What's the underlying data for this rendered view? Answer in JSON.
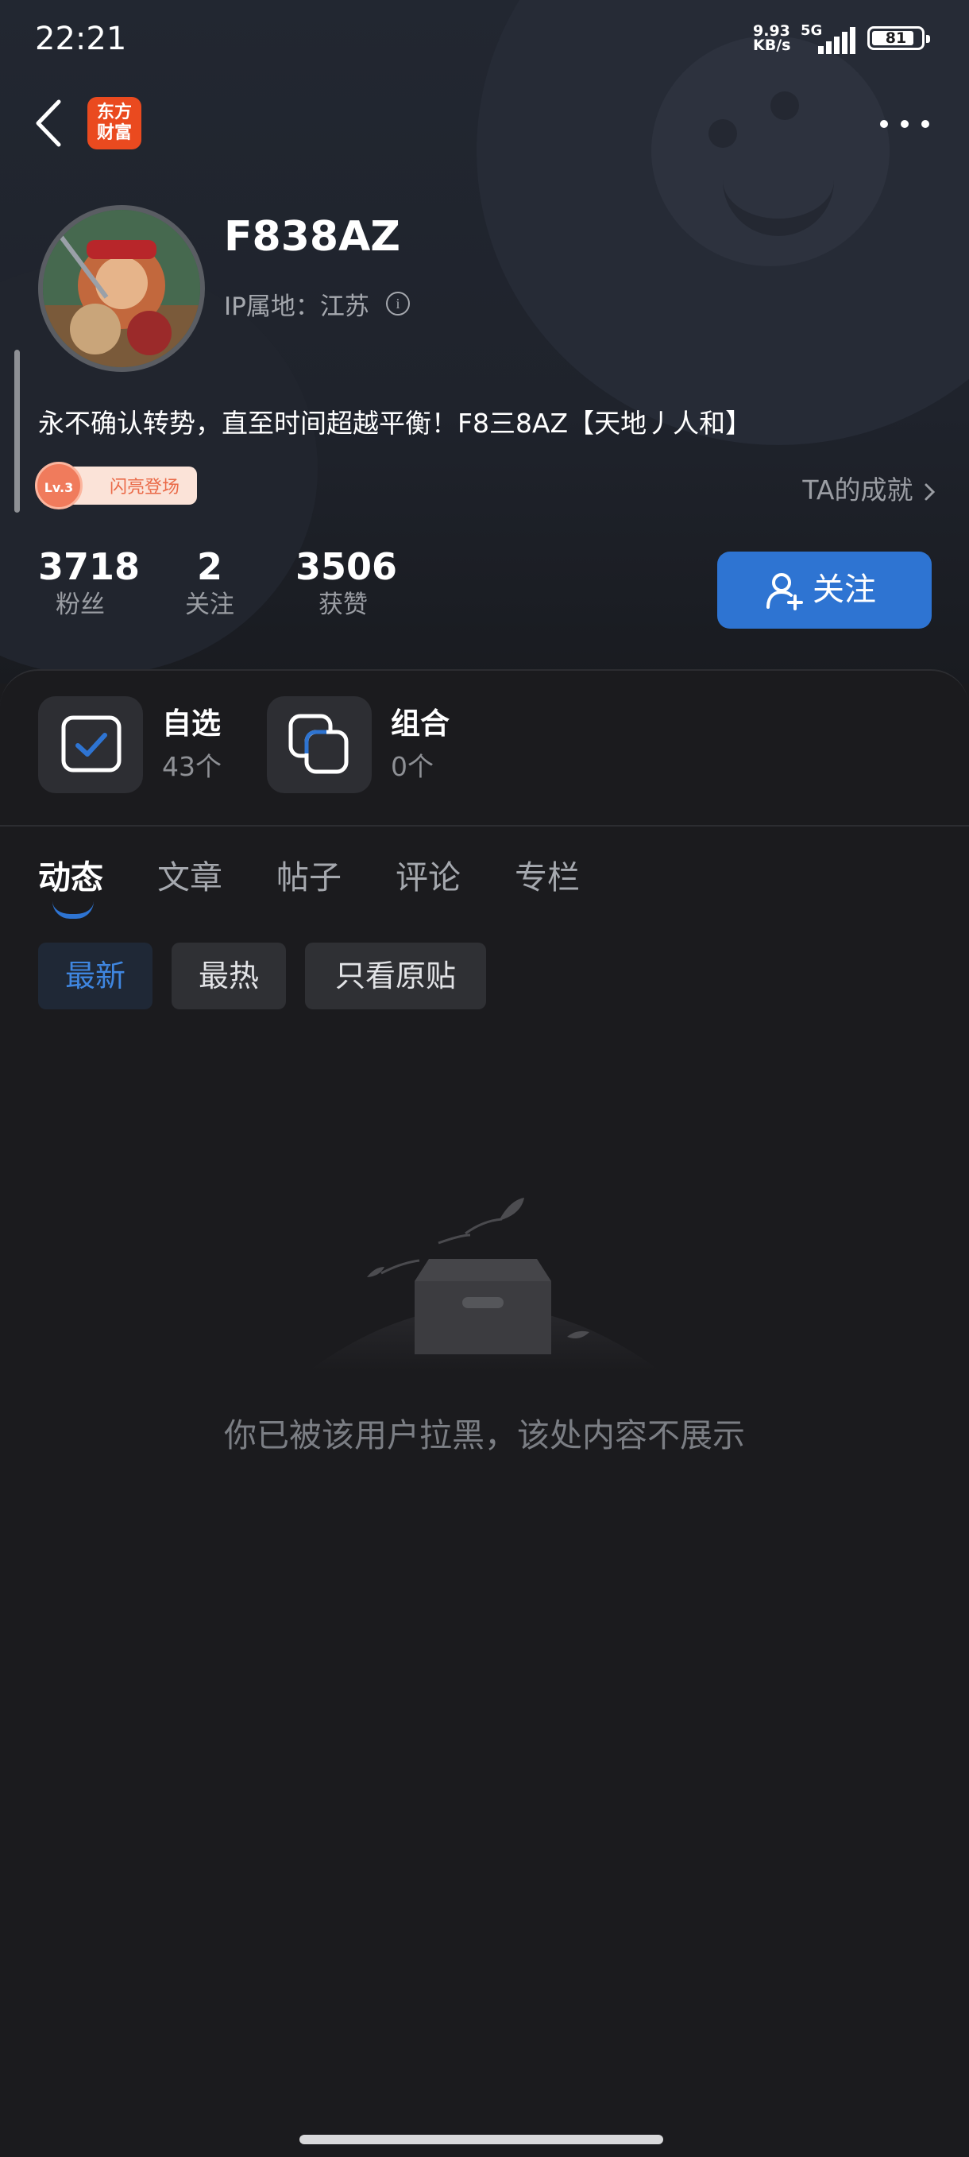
{
  "status_bar": {
    "time": "22:21",
    "net_speed_value": "9.93",
    "net_speed_unit": "KB/s",
    "network": "5G",
    "battery": "81"
  },
  "header": {
    "logo_line1": "东方",
    "logo_line2": "财富"
  },
  "profile": {
    "username": "F838AZ",
    "ip_location": "IP属地：江苏",
    "bio": "永不确认转势，直至时间超越平衡！F8三8AZ【天地丿人和】",
    "badge_level": "Lv.3",
    "badge_text": "闪亮登场",
    "achievements_link": "TA的成就"
  },
  "stats": [
    {
      "value": "3718",
      "label": "粉丝"
    },
    {
      "value": "2",
      "label": "关注"
    },
    {
      "value": "3506",
      "label": "获赞"
    }
  ],
  "follow_button": "关注",
  "quick_links": [
    {
      "title": "自选",
      "subtitle": "43个",
      "icon": "checkbox-icon"
    },
    {
      "title": "组合",
      "subtitle": "0个",
      "icon": "overlap-squares-icon"
    }
  ],
  "tabs": [
    "动态",
    "文章",
    "帖子",
    "评论",
    "专栏"
  ],
  "filters": [
    "最新",
    "最热",
    "只看原贴"
  ],
  "empty_message": "你已被该用户拉黑，该处内容不展示",
  "colors": {
    "accent": "#2e74d2",
    "background": "#1b1b1e",
    "logo": "#ea4a1f"
  }
}
